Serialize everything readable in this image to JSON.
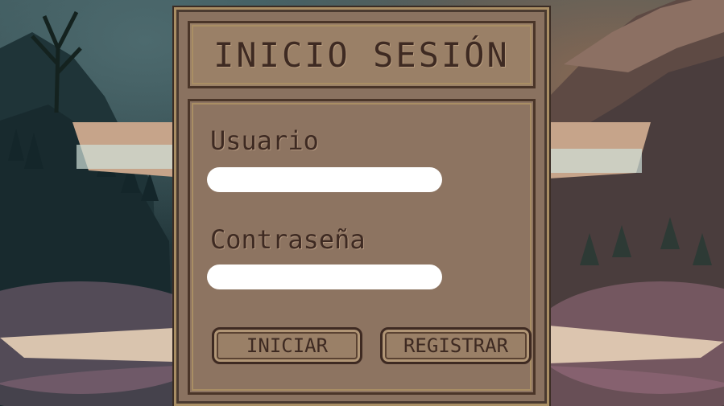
{
  "login": {
    "title": "INICIO SESIÓN",
    "username_label": "Usuario",
    "username_value": "",
    "password_label": "Contraseña",
    "password_value": "",
    "login_button": "INICIAR",
    "register_button": "REGISTRAR"
  },
  "colors": {
    "panel": "#8a7260",
    "panel_border": "#a98e64",
    "text": "#3e2a22",
    "input": "#ffffff"
  }
}
